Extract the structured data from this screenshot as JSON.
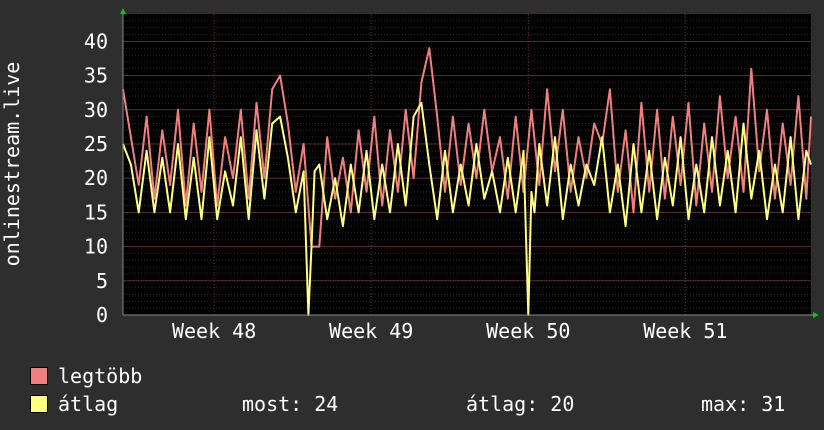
{
  "chart_data": {
    "type": "line",
    "ylabel": "onlinestream.live",
    "ylim": [
      0,
      44
    ],
    "yticks": [
      0,
      5,
      10,
      15,
      20,
      25,
      30,
      35,
      40
    ],
    "x_tick_labels": [
      "Week 48",
      "Week 49",
      "Week 50",
      "Week 51"
    ],
    "x_week_positions": [
      1.0,
      2.0,
      3.0,
      4.0
    ],
    "xlim": [
      0.42,
      4.8
    ],
    "grid": true,
    "series": [
      {
        "name": "legtöbb",
        "color": "#f07f7f",
        "x": [
          0.42,
          0.47,
          0.52,
          0.57,
          0.62,
          0.67,
          0.72,
          0.77,
          0.82,
          0.87,
          0.92,
          0.97,
          1.02,
          1.07,
          1.12,
          1.17,
          1.22,
          1.27,
          1.32,
          1.37,
          1.42,
          1.47,
          1.52,
          1.57,
          1.62,
          1.67,
          1.72,
          1.77,
          1.82,
          1.87,
          1.92,
          1.97,
          2.02,
          2.07,
          2.12,
          2.17,
          2.22,
          2.27,
          2.32,
          2.37,
          2.42,
          2.47,
          2.52,
          2.57,
          2.62,
          2.67,
          2.72,
          2.77,
          2.82,
          2.87,
          2.92,
          2.97,
          3.02,
          3.07,
          3.12,
          3.17,
          3.22,
          3.27,
          3.32,
          3.37,
          3.42,
          3.47,
          3.52,
          3.57,
          3.62,
          3.67,
          3.72,
          3.77,
          3.82,
          3.87,
          3.92,
          3.97,
          4.02,
          4.07,
          4.12,
          4.17,
          4.22,
          4.27,
          4.32,
          4.37,
          4.42,
          4.47,
          4.52,
          4.57,
          4.62,
          4.67,
          4.72,
          4.77,
          4.8
        ],
        "values": [
          33,
          26,
          19,
          29,
          17,
          27,
          19,
          30,
          16,
          28,
          18,
          30,
          16,
          26,
          20,
          30,
          17,
          31,
          20,
          33,
          35,
          28,
          18,
          25,
          10,
          10,
          26,
          17,
          23,
          15,
          27,
          18,
          29,
          16,
          27,
          18,
          30,
          20,
          34,
          39,
          29,
          18,
          29,
          19,
          28,
          20,
          30,
          21,
          26,
          17,
          29,
          18,
          30,
          19,
          33,
          21,
          30,
          18,
          26,
          20,
          28,
          25,
          33,
          18,
          27,
          15,
          31,
          18,
          30,
          17,
          29,
          19,
          31,
          16,
          28,
          18,
          32,
          20,
          29,
          18,
          36,
          21,
          30,
          17,
          28,
          19,
          32,
          17,
          29
        ]
      },
      {
        "name": "átlag",
        "color": "#ffff80",
        "x": [
          0.42,
          0.47,
          0.52,
          0.57,
          0.62,
          0.67,
          0.72,
          0.77,
          0.82,
          0.87,
          0.92,
          0.97,
          1.02,
          1.07,
          1.12,
          1.17,
          1.22,
          1.27,
          1.32,
          1.37,
          1.42,
          1.47,
          1.52,
          1.57,
          1.6,
          1.62,
          1.64,
          1.67,
          1.72,
          1.77,
          1.82,
          1.87,
          1.92,
          1.97,
          2.02,
          2.07,
          2.12,
          2.17,
          2.22,
          2.27,
          2.32,
          2.37,
          2.42,
          2.47,
          2.52,
          2.57,
          2.62,
          2.67,
          2.72,
          2.77,
          2.82,
          2.87,
          2.92,
          2.97,
          3.0,
          3.02,
          3.04,
          3.07,
          3.12,
          3.17,
          3.22,
          3.27,
          3.32,
          3.37,
          3.42,
          3.47,
          3.52,
          3.57,
          3.62,
          3.67,
          3.72,
          3.77,
          3.82,
          3.87,
          3.92,
          3.97,
          4.02,
          4.07,
          4.12,
          4.17,
          4.22,
          4.27,
          4.32,
          4.37,
          4.42,
          4.47,
          4.52,
          4.57,
          4.62,
          4.67,
          4.72,
          4.77,
          4.8
        ],
        "values": [
          25,
          22,
          15,
          24,
          15,
          23,
          15,
          25,
          14,
          23,
          14,
          26,
          14,
          21,
          16,
          26,
          14,
          27,
          17,
          28,
          29,
          23,
          15,
          21,
          0,
          10,
          21,
          22,
          14,
          20,
          13,
          22,
          15,
          24,
          14,
          22,
          15,
          25,
          16,
          29,
          31,
          22,
          14,
          24,
          15,
          22,
          16,
          25,
          17,
          21,
          15,
          23,
          15,
          24,
          0,
          18,
          15,
          25,
          16,
          26,
          14,
          22,
          16,
          22,
          19,
          26,
          15,
          22,
          13,
          25,
          15,
          24,
          14,
          23,
          16,
          26,
          14,
          22,
          15,
          26,
          16,
          24,
          15,
          28,
          17,
          24,
          14,
          22,
          15,
          26,
          14,
          24,
          22
        ]
      }
    ]
  },
  "legend": {
    "items": [
      {
        "label": "legtöbb",
        "color": "#f07f7f"
      },
      {
        "label": "átlag",
        "color": "#ffff80"
      }
    ],
    "stats": {
      "current": "most: 24",
      "average": "átlag: 20",
      "maximum": "max: 31"
    }
  }
}
